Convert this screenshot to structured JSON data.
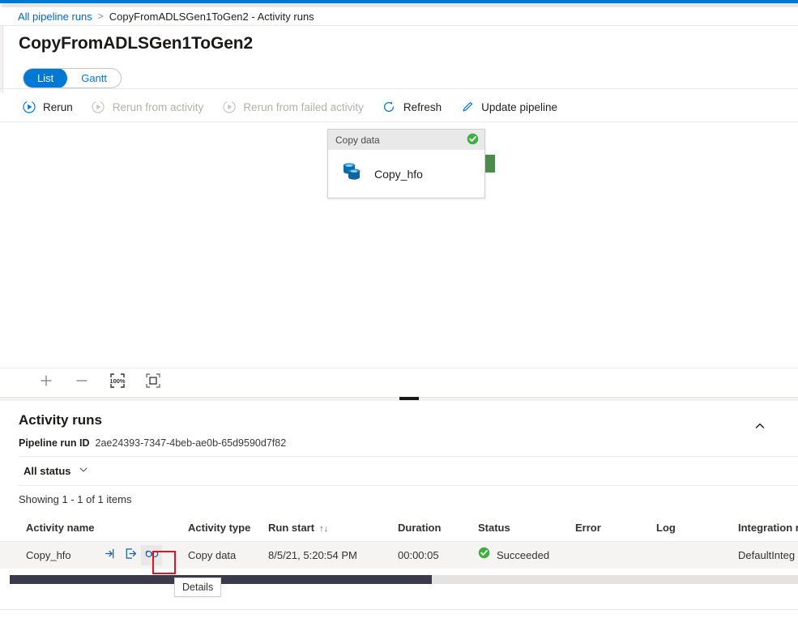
{
  "breadcrumb": {
    "link": "All pipeline runs",
    "separator": ">",
    "current": "CopyFromADLSGen1ToGen2 - Activity runs"
  },
  "page": {
    "title": "CopyFromADLSGen1ToGen2"
  },
  "view_toggle": {
    "items": [
      {
        "label": "List",
        "selected": true
      },
      {
        "label": "Gantt",
        "selected": false
      }
    ]
  },
  "commandbar": {
    "items": [
      {
        "label": "Rerun",
        "icon": "rerun-icon",
        "disabled": false
      },
      {
        "label": "Rerun from activity",
        "icon": "rerun-from-activity-icon",
        "disabled": true
      },
      {
        "label": "Rerun from failed activity",
        "icon": "rerun-from-failed-activity-icon",
        "disabled": true
      },
      {
        "label": "Refresh",
        "icon": "refresh-icon",
        "disabled": false
      },
      {
        "label": "Update pipeline",
        "icon": "pencil-icon",
        "disabled": false
      }
    ]
  },
  "canvas": {
    "node": {
      "type_label": "Copy data",
      "name": "Copy_hfo",
      "status_icon": "success-check-icon",
      "activity_icon": "copy-data-icon"
    },
    "controls": [
      {
        "icon": "zoom-in-icon",
        "label": "+"
      },
      {
        "icon": "zoom-out-icon",
        "label": "−"
      },
      {
        "icon": "zoom-100-icon",
        "label": "100%"
      },
      {
        "icon": "fit-to-screen-icon",
        "label": ""
      }
    ]
  },
  "activity_runs": {
    "title": "Activity runs",
    "collapse_icon": "chevron-up-icon",
    "run_id_label": "Pipeline run ID",
    "run_id_value": "2ae24393-7347-4beb-ae0b-65d9590d7f82",
    "status_filter": "All status",
    "showing": "Showing 1 - 1 of 1 items",
    "columns": [
      "Activity name",
      "Activity type",
      "Run start",
      "Duration",
      "Status",
      "Error",
      "Log",
      "Integration r"
    ],
    "sort_column": "Run start",
    "rows": [
      {
        "activity_name": "Copy_hfo",
        "activity_type": "Copy data",
        "run_start": "8/5/21, 5:20:54 PM",
        "duration": "00:00:05",
        "status": "Succeeded",
        "error": "",
        "log": "",
        "integration_runtime": "DefaultInteg"
      }
    ],
    "row_actions": [
      {
        "name": "input-icon",
        "title": "Input"
      },
      {
        "name": "output-icon",
        "title": "Output"
      },
      {
        "name": "details-icon",
        "title": "Details"
      }
    ]
  },
  "tooltip": {
    "text": "Details"
  },
  "colors": {
    "accent": "#0078d4",
    "success": "#4caf28",
    "highlight": "#e81123",
    "node_port": "#4b8b4b"
  }
}
